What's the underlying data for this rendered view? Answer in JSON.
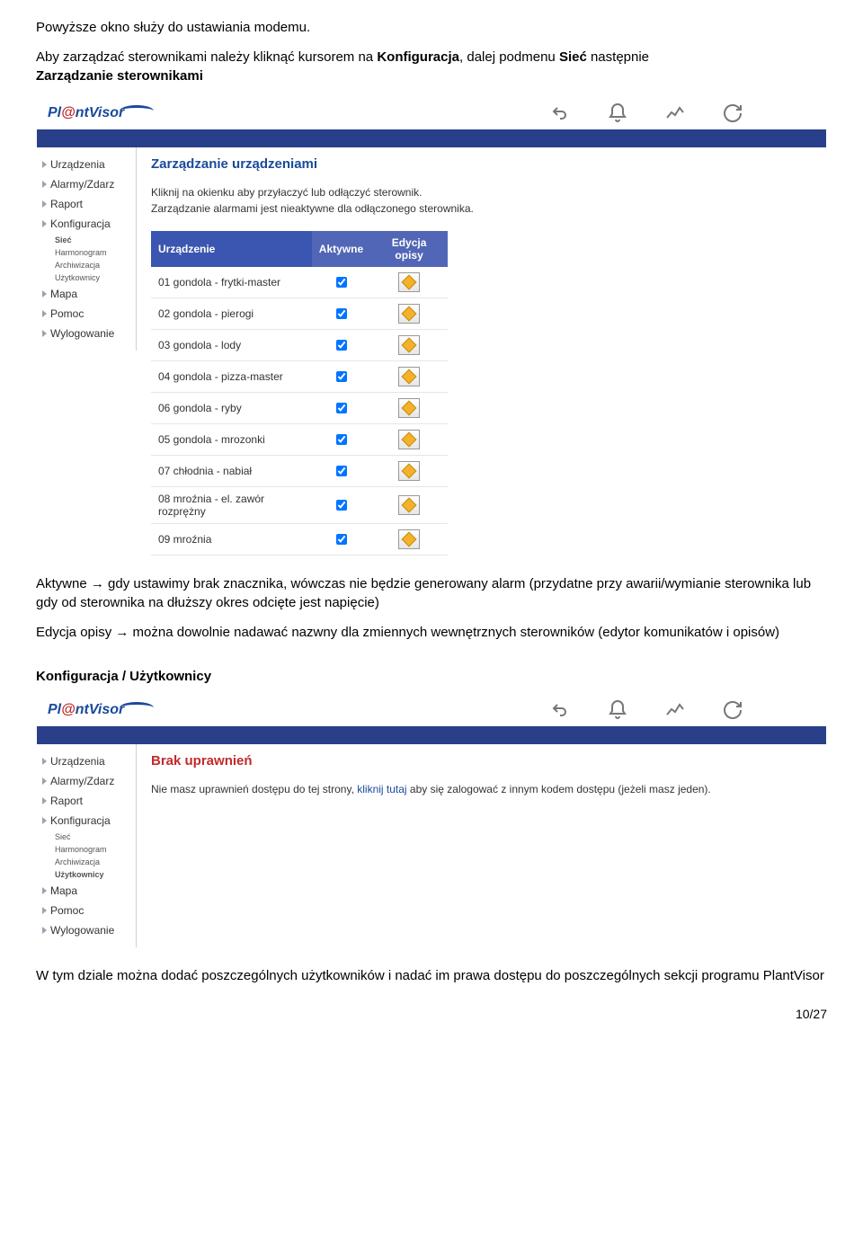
{
  "doc": {
    "intro": "Powyższe okno służy do ustawiania modemu.",
    "p2_a": "Aby zarządzać sterownikami należy kliknąć kursorem na ",
    "p2_b": "Konfiguracja",
    "p2_c": ", dalej podmenu ",
    "p2_d": "Sieć",
    "p2_e": " następnie ",
    "p2_f": "Zarządzanie sterownikami",
    "after1": "Aktywne → gdy ustawimy brak znacznika, wówczas nie będzie generowany alarm (przydatne przy awarii/wymianie sterownika lub gdy od sterownika na dłuższy okres odcięte jest napięcie)",
    "after2": "Edycja opisy → można dowolnie nadawać nazwny dla zmiennych wewnętrznych sterowników (edytor komunikatów i opisów)",
    "h2": "Konfiguracja / Użytkownicy",
    "after3": "W tym dziale można dodać poszczególnych użytkowników i nadać im prawa dostępu do poszczególnych sekcji programu PlantVisor",
    "pagenum": "10/27"
  },
  "logo": {
    "a": "Pl",
    "b": "@",
    "c": "ntVisor"
  },
  "side": {
    "items": [
      "Urządzenia",
      "Alarmy/Zdarz",
      "Raport",
      "Konfiguracja"
    ],
    "subs": [
      "Sieć",
      "Harmonogram",
      "Archiwizacja",
      "Użytkownicy"
    ],
    "items2": [
      "Mapa",
      "Pomoc",
      "Wylogowanie"
    ]
  },
  "scr1": {
    "title": "Zarządzanie urządzeniami",
    "help1": "Kliknij na okienku aby przyłaczyć lub odłączyć sterownik.",
    "help2": "Zarządzanie alarmami jest nieaktywne dla odłączonego sterownika.",
    "th": {
      "dev": "Urządzenie",
      "active": "Aktywne",
      "edit": "Edycja opisy"
    },
    "rows": [
      {
        "name": "01 gondola - frytki-master"
      },
      {
        "name": "02 gondola - pierogi"
      },
      {
        "name": "03 gondola - lody"
      },
      {
        "name": "04 gondola - pizza-master"
      },
      {
        "name": "06 gondola - ryby"
      },
      {
        "name": "05 gondola - mrozonki"
      },
      {
        "name": "07 chłodnia - nabiał"
      },
      {
        "name": "08 mroźnia - el. zawór rozprężny"
      },
      {
        "name": "09 mroźnia"
      }
    ],
    "selSub": "Sieć"
  },
  "scr2": {
    "title": "Brak uprawnień",
    "text_a": "Nie masz uprawnień dostępu do tej strony, ",
    "text_b": "kliknij tutaj",
    "text_c": " aby się zalogować z innym kodem dostępu (jeżeli masz jeden).",
    "selSub": "Użytkownicy"
  }
}
